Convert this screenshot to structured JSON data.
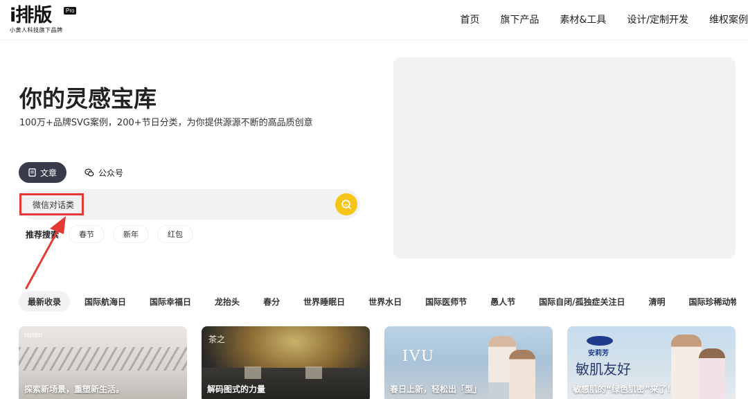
{
  "header": {
    "logo_text": "i排版",
    "logo_badge": "Pro",
    "logo_sub": "小黄人科技旗下品牌",
    "nav": [
      "首页",
      "旗下产品",
      "素材&工具",
      "设计/定制开发",
      "维权案例"
    ]
  },
  "hero": {
    "title": "你的灵感宝库",
    "subtitle": "100万+品牌SVG案例，200+节日分类，为你提供源源不断的高品质创意"
  },
  "tabs": [
    {
      "label": "文章",
      "icon": "document-icon"
    },
    {
      "label": "公众号",
      "icon": "wechat-icon"
    }
  ],
  "search": {
    "value": "微信对话类",
    "button_icon": "search-icon"
  },
  "recommend": {
    "label": "推荐搜索",
    "tags": [
      "春节",
      "新年",
      "红包"
    ]
  },
  "categories": [
    "最新收录",
    "国际航海日",
    "国际幸福日",
    "龙抬头",
    "春分",
    "世界睡眠日",
    "世界水日",
    "国际医师节",
    "愚人节",
    "国际自闭/孤独症关注日",
    "清明",
    "国际珍稀动物保护日"
  ],
  "cards": [
    {
      "title": "探索新场景，重塑新生活。",
      "brand": "laifen"
    },
    {
      "title": "解码图式的力量",
      "brand": "茶之"
    },
    {
      "title": "春日上新，轻松出「型」",
      "brand": "IVU"
    },
    {
      "title": "敏感肌的“绿色肌密”来了！",
      "brand": "安莉芳",
      "overlay": "敏肌友好"
    }
  ],
  "colors": {
    "accent_yellow": "#f5c518",
    "tab_active": "#3a3b4a",
    "highlight_red": "#e53935",
    "panel_gray": "#f2f2f4"
  }
}
